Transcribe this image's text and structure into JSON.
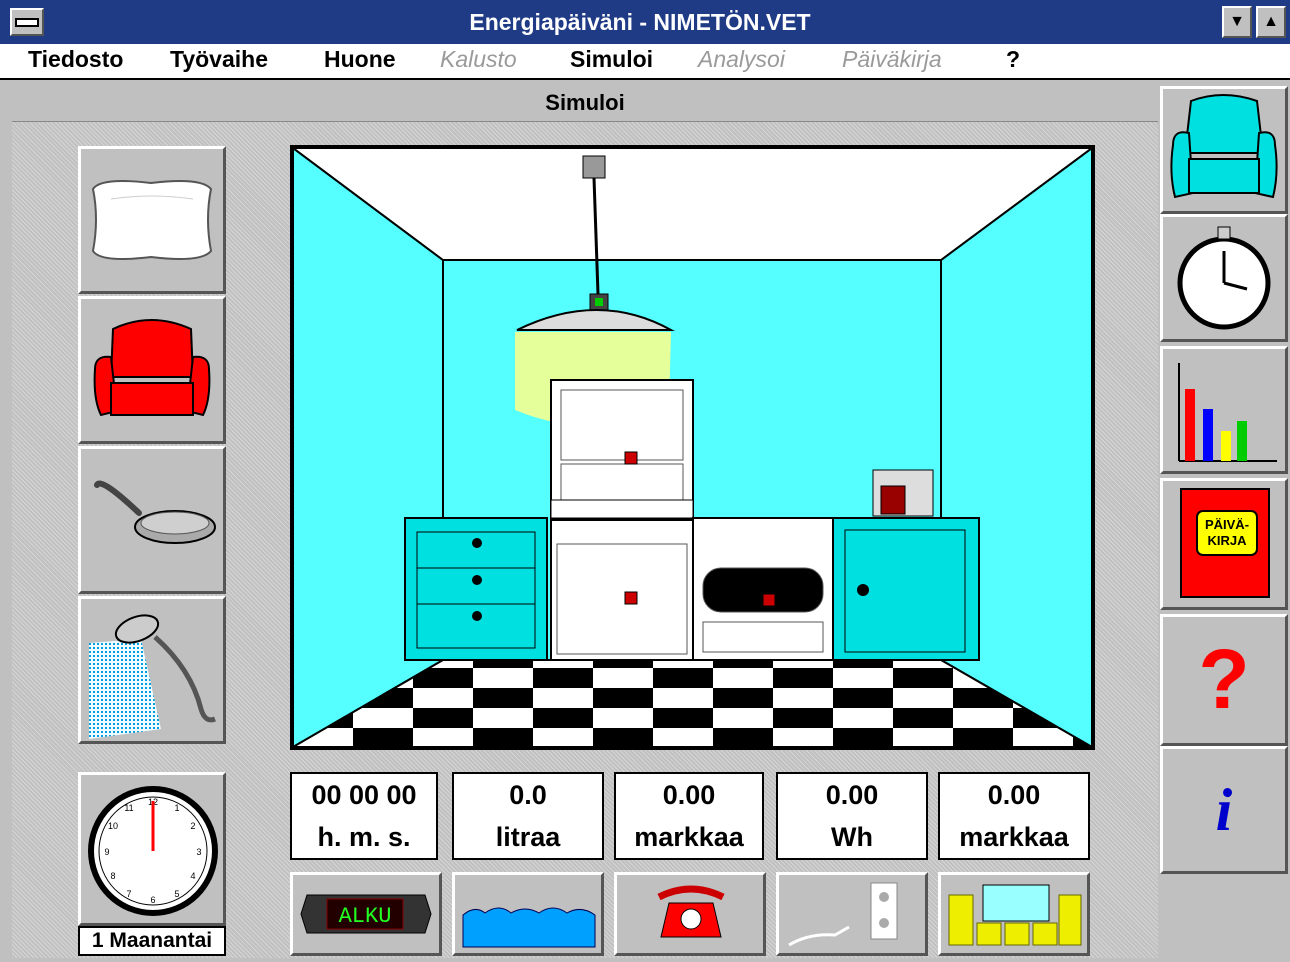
{
  "window": {
    "title": "Energiapäiväni - NIMETÖN.VET",
    "minimize_symbol": "▼",
    "maximize_symbol": "▲"
  },
  "menu": {
    "items": [
      {
        "label": "Tiedosto",
        "enabled": true
      },
      {
        "label": "Työvaihe",
        "enabled": true
      },
      {
        "label": "Huone",
        "enabled": true
      },
      {
        "label": "Kalusto",
        "enabled": false
      },
      {
        "label": "Simuloi",
        "enabled": true
      },
      {
        "label": "Analysoi",
        "enabled": false
      },
      {
        "label": "Päiväkirja",
        "enabled": false
      },
      {
        "label": "?",
        "enabled": true
      }
    ]
  },
  "panel": {
    "title": "Simuloi"
  },
  "left_tools": [
    {
      "icon": "pillow-icon"
    },
    {
      "icon": "red-armchair-icon"
    },
    {
      "icon": "frying-pan-icon"
    },
    {
      "icon": "shower-icon"
    }
  ],
  "clock": {
    "day_label": "1 Maanantai"
  },
  "readouts": [
    {
      "value": "00 00 00",
      "unit": "h. m. s."
    },
    {
      "value": "0.0",
      "unit": "litraa"
    },
    {
      "value": "0.00",
      "unit": "markkaa"
    },
    {
      "value": "0.00",
      "unit": "Wh"
    },
    {
      "value": "0.00",
      "unit": "markkaa"
    }
  ],
  "bottom_buttons": [
    {
      "icon": "alku-display-icon",
      "text": "ALKU"
    },
    {
      "icon": "water-icon"
    },
    {
      "icon": "telephone-icon"
    },
    {
      "icon": "power-plug-icon"
    },
    {
      "icon": "money-icon"
    }
  ],
  "right_buttons": [
    {
      "icon": "cyan-armchair-icon"
    },
    {
      "icon": "stopwatch-icon"
    },
    {
      "icon": "bar-chart-icon"
    },
    {
      "icon": "diary-book-icon",
      "text_line1": "PÄIVÄ-",
      "text_line2": "KIRJA"
    },
    {
      "icon": "help-question-icon",
      "text": "?"
    },
    {
      "icon": "info-icon",
      "text": "i"
    }
  ],
  "colors": {
    "titlebar": "#1f3b86",
    "room_wall": "#55ffff",
    "cabinet": "#00e0e0",
    "lamp_light": "#ffff88",
    "readout_bg": "#ffffff"
  }
}
